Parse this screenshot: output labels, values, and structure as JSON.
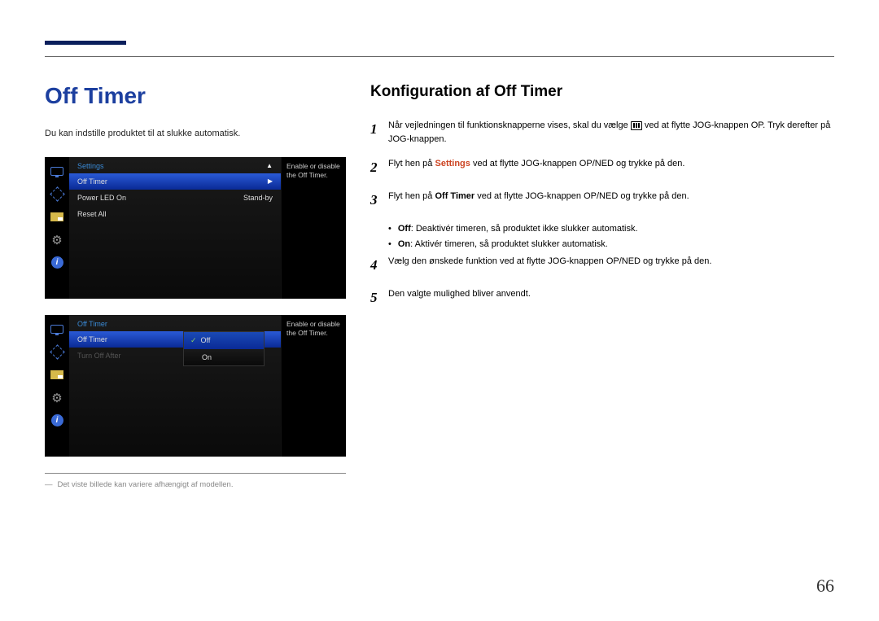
{
  "header": {
    "main_title": "Off Timer",
    "subtitle": "Du kan indstille produktet til at slukke automatisk."
  },
  "osd1": {
    "breadcrumb": "Settings",
    "rows": [
      {
        "label": "Off Timer",
        "value": ""
      },
      {
        "label": "Power LED On",
        "value": "Stand-by"
      },
      {
        "label": "Reset All",
        "value": ""
      }
    ],
    "desc": "Enable or disable the Off Timer."
  },
  "osd2": {
    "breadcrumb": "Off Timer",
    "rows": [
      {
        "label": "Off Timer"
      },
      {
        "label": "Turn Off After"
      }
    ],
    "submenu": {
      "opt1": "Off",
      "opt2": "On"
    },
    "desc": "Enable or disable the Off Timer."
  },
  "right": {
    "section_title": "Konfiguration af Off Timer",
    "steps": {
      "s1a": "Når vejledningen til funktionsknapperne vises, skal du vælge ",
      "s1b": " ved at flytte JOG-knappen OP. Tryk derefter på JOG-knappen.",
      "s2a": "Flyt hen på ",
      "s2hl": "Settings",
      "s2b": " ved at flytte JOG-knappen OP/NED og trykke på den.",
      "s3a": "Flyt hen på ",
      "s3b": "Off Timer",
      "s3c": " ved at flytte JOG-knappen OP/NED og trykke på den.",
      "b1hl": "Off",
      "b1": ": Deaktivér timeren, så produktet ikke slukker automatisk.",
      "b2b": "On",
      "b2": ": Aktivér timeren, så produktet slukker automatisk.",
      "s4": "Vælg den ønskede funktion ved at flytte JOG-knappen OP/NED og trykke på den.",
      "s5": "Den valgte mulighed bliver anvendt."
    },
    "nums": {
      "n1": "1",
      "n2": "2",
      "n3": "3",
      "n4": "4",
      "n5": "5"
    }
  },
  "footnote": {
    "dash": "―",
    "text": "Det viste billede kan variere afhængigt af modellen."
  },
  "page_number": "66"
}
